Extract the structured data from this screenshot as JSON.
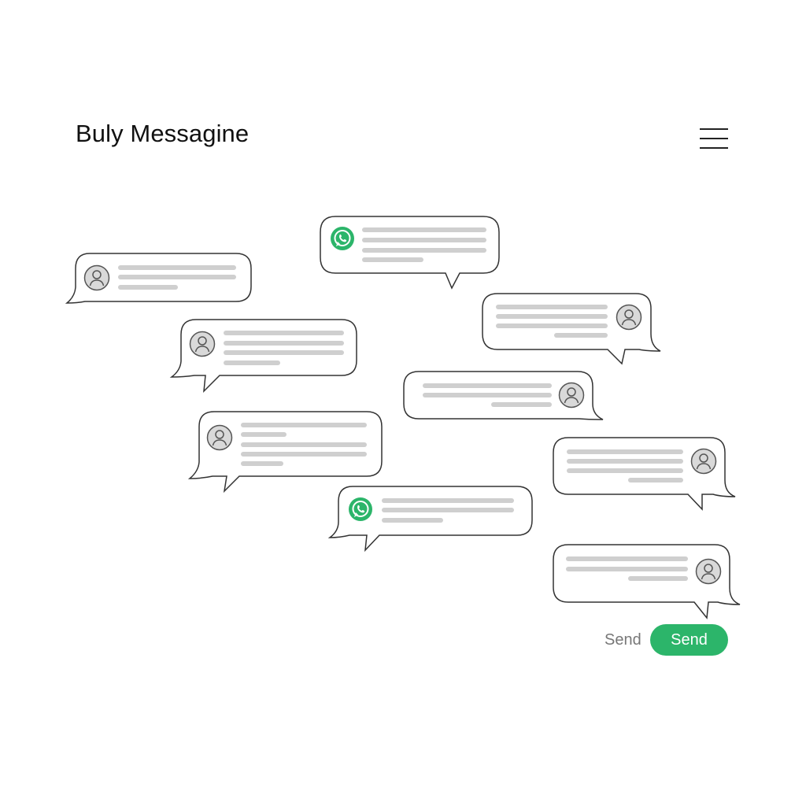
{
  "header": {
    "title": "Buly Messagine",
    "menu_icon": "hamburger-menu-icon"
  },
  "colors": {
    "accent": "#2cb56a",
    "placeholder_line": "#cfcfcf",
    "bubble_border": "#333333",
    "avatar_fill": "#d9d9d9"
  },
  "messages": [
    {
      "id": "m1",
      "icon": "whatsapp-icon",
      "text_lines": 4
    },
    {
      "id": "m2",
      "icon": "user-avatar-icon",
      "text_lines": 3
    },
    {
      "id": "m3",
      "icon": "user-avatar-icon",
      "text_lines": 4
    },
    {
      "id": "m4",
      "icon": "user-avatar-icon",
      "text_lines": 4
    },
    {
      "id": "m5",
      "icon": "user-avatar-icon",
      "text_lines": 3
    },
    {
      "id": "m6",
      "icon": "user-avatar-icon",
      "text_lines": 5
    },
    {
      "id": "m7",
      "icon": "user-avatar-icon",
      "text_lines": 4
    },
    {
      "id": "m8",
      "icon": "whatsapp-icon",
      "text_lines": 3
    },
    {
      "id": "m9",
      "icon": "user-avatar-icon",
      "text_lines": 3
    }
  ],
  "composer": {
    "send_label": "Send",
    "send_button_label": "Send"
  }
}
